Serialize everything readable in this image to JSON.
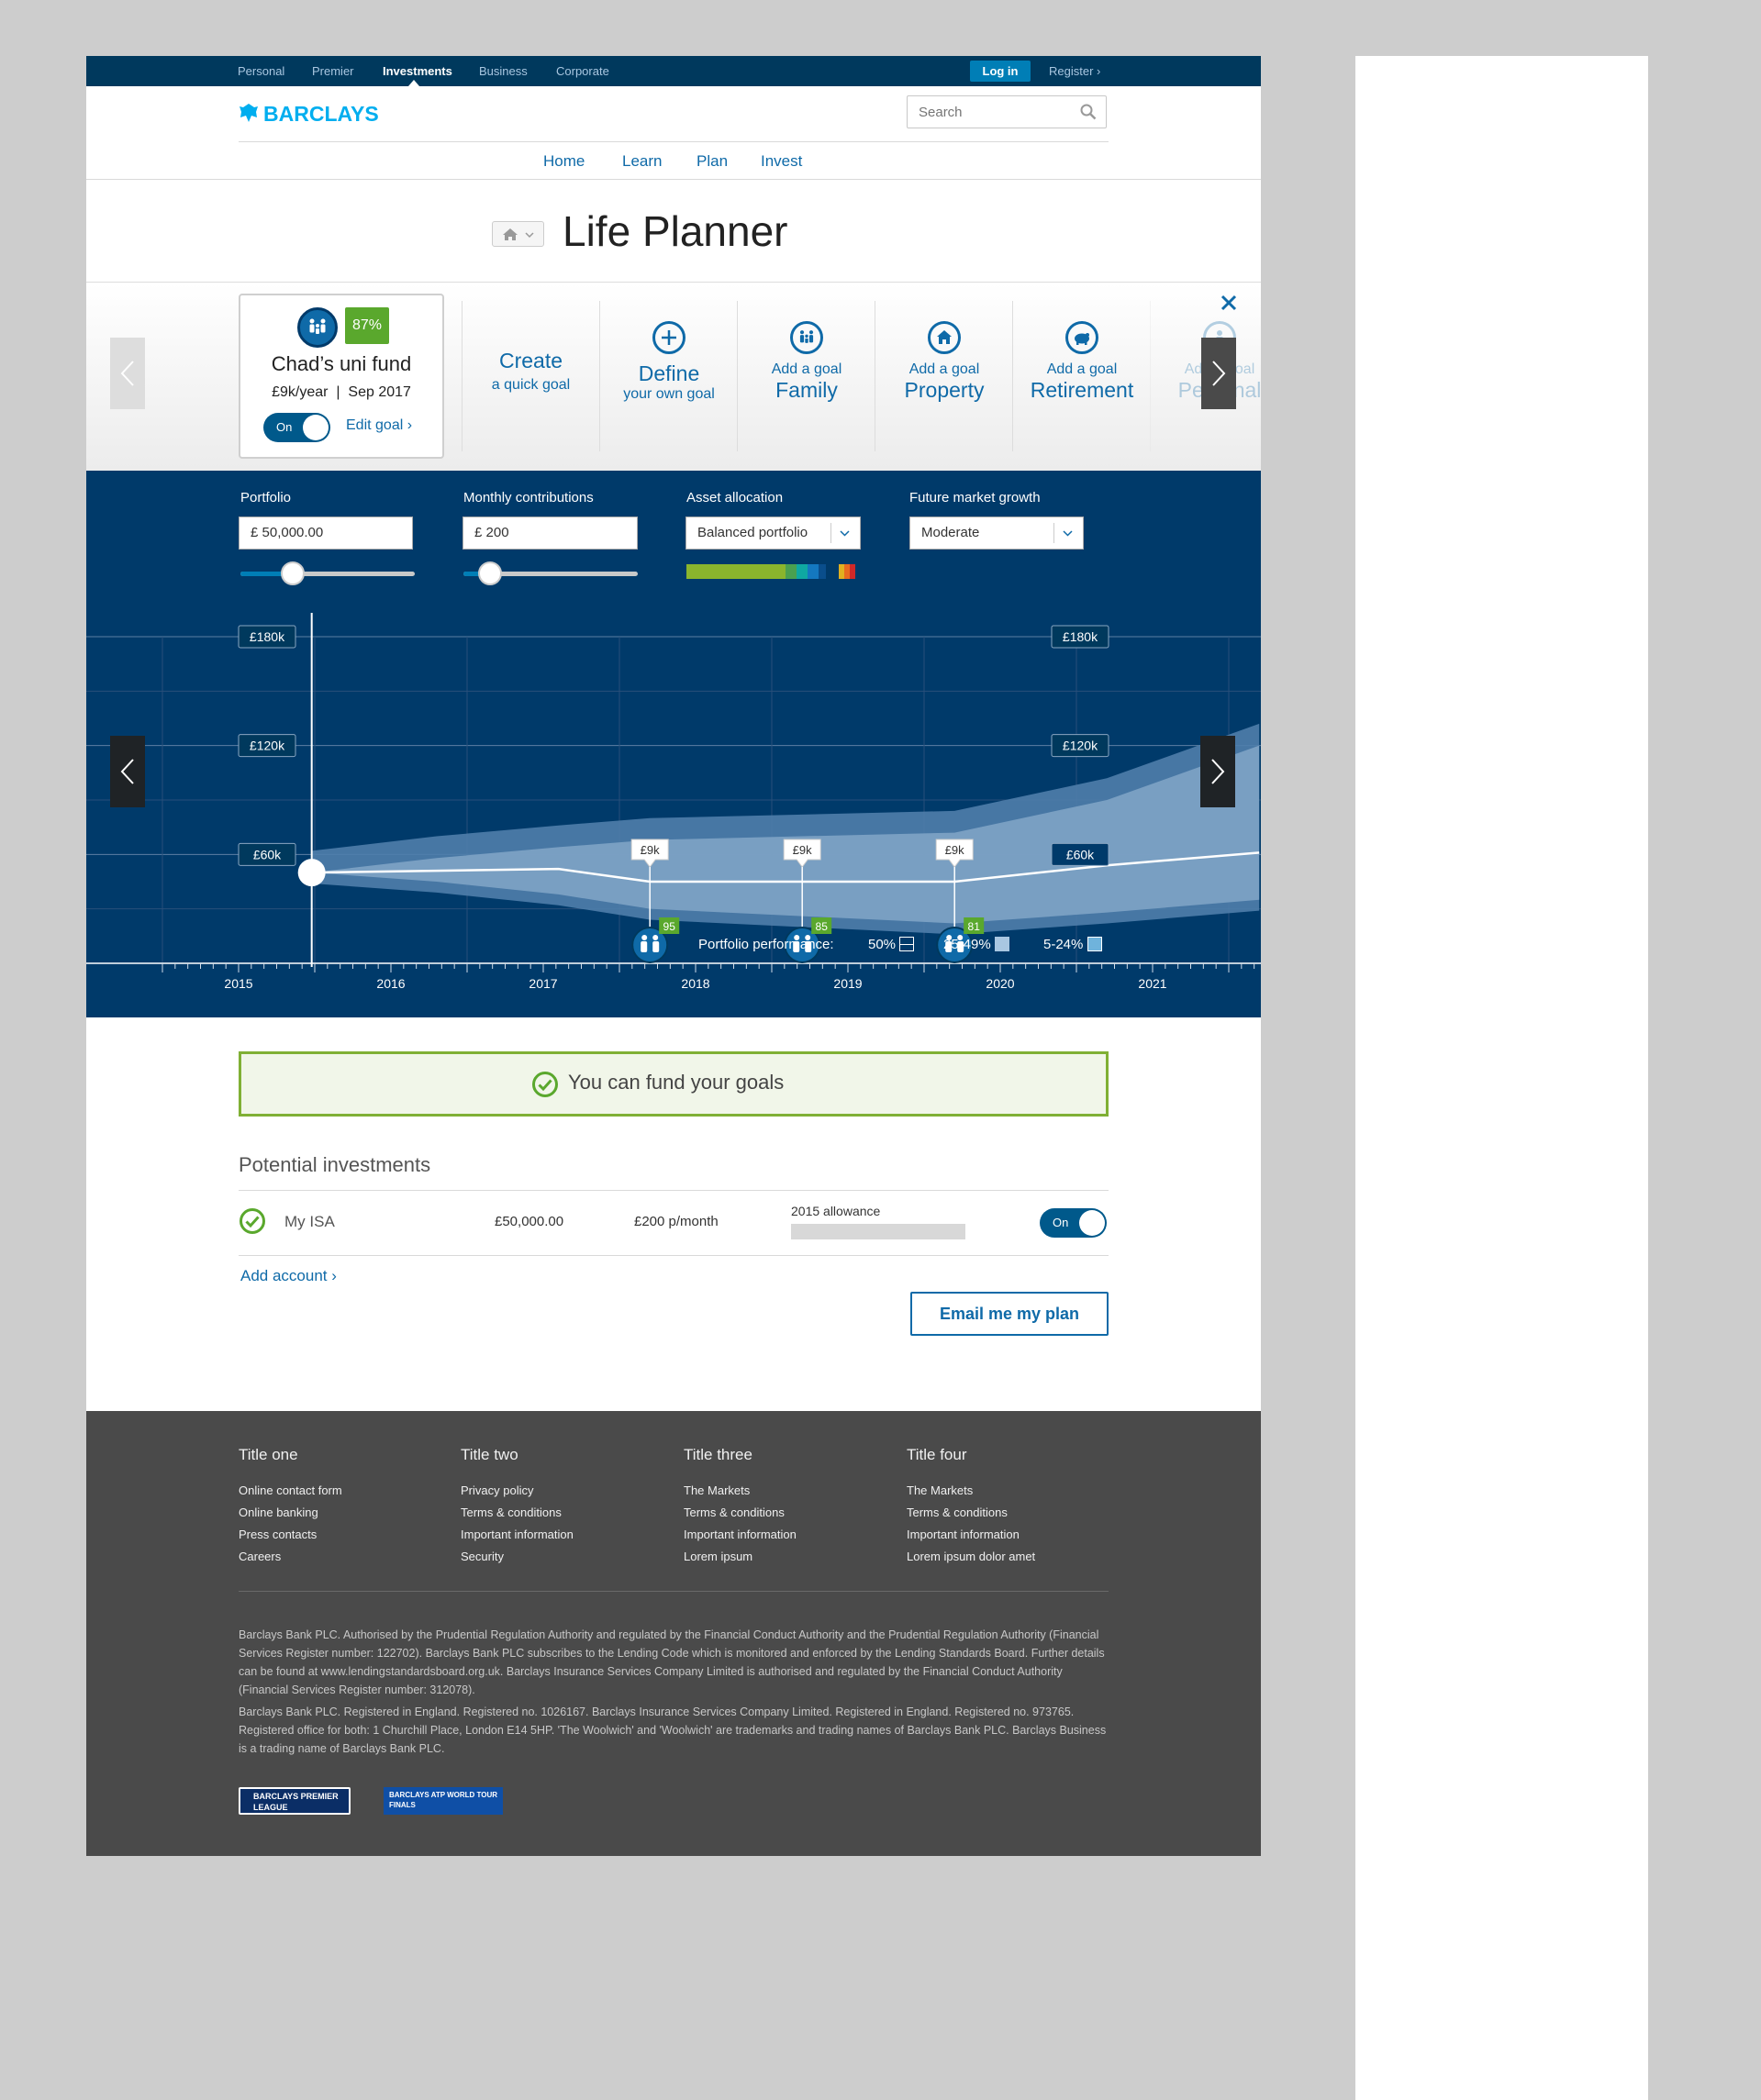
{
  "topnav": {
    "items": [
      "Personal",
      "Premier",
      "Investments",
      "Business",
      "Corporate"
    ],
    "active": "Investments",
    "login": "Log in",
    "register": "Register"
  },
  "header": {
    "logo_text": "BARCLAYS",
    "search_placeholder": "Search"
  },
  "subnav": [
    "Home",
    "Learn",
    "Plan",
    "Invest"
  ],
  "page_title": "Life Planner",
  "goal_card": {
    "title": "Chad’s uni fund",
    "percent": "87%",
    "details": "£9k/year  |  Sep 2017",
    "toggle": "On",
    "edit": "Edit goal"
  },
  "goal_options": [
    {
      "line1": "Create",
      "line2": "a quick goal"
    },
    {
      "line1": "Define",
      "line2": "your own goal"
    },
    {
      "line1": "Add a goal",
      "line2": "Family"
    },
    {
      "line1": "Add a goal",
      "line2": "Property"
    },
    {
      "line1": "Add a goal",
      "line2": "Retirement"
    },
    {
      "line1": "Add a goal",
      "line2": "Personal"
    }
  ],
  "controls": {
    "portfolio": {
      "label": "Portfolio",
      "value": "£ 50,000.00",
      "slider_level": 0.3
    },
    "monthly": {
      "label": "Monthly contributions",
      "value": "£ 200",
      "slider_level": 0.15
    },
    "allocation": {
      "label": "Asset allocation",
      "value": "Balanced portfolio"
    },
    "growth": {
      "label": "Future market growth",
      "value": "Moderate"
    }
  },
  "colors": {
    "navy": "#00395d",
    "chart_bg": "#003a6a",
    "accent": "#0f6aa8",
    "green": "#5aa82d",
    "footer": "#4a4a4a"
  },
  "chart_data": {
    "type": "area",
    "x": [
      "2015",
      "2016",
      "2017",
      "2018",
      "2019",
      "2020",
      "2021"
    ],
    "y_ticks": [
      "£180k",
      "£120k",
      "£60k"
    ],
    "ylim": [
      0,
      180
    ],
    "series": [
      {
        "name": "50%",
        "values": [
          50,
          51,
          52,
          45,
          45,
          45,
          54,
          61
        ]
      },
      {
        "name": "25-49%",
        "values": [
          50,
          58,
          64,
          68,
          70,
          72,
          90,
          120
        ]
      },
      {
        "name": "5-24%",
        "values": [
          50,
          45,
          38,
          30,
          26,
          22,
          28,
          35
        ]
      }
    ],
    "withdrawals": [
      {
        "label": "£9k",
        "year": 2017.7,
        "score": "95"
      },
      {
        "label": "£9k",
        "year": 2018.7,
        "score": "85"
      },
      {
        "label": "£9k",
        "year": 2019.7,
        "score": "81"
      }
    ],
    "current_value_label": "£60k",
    "legend_title": "Portfolio performance:",
    "legend": [
      "50%",
      "25-49%",
      "5-24%"
    ]
  },
  "fund_status": "You can fund your goals",
  "investments": {
    "title": "Potential investments",
    "rows": [
      {
        "name": "My ISA",
        "amount": "£50,000.00",
        "monthly": "£200 p/month",
        "allowance_label": "2015 allowance",
        "toggle": "On"
      }
    ],
    "add_account": "Add account",
    "email_button": "Email me my plan"
  },
  "footer": {
    "columns": [
      {
        "title": "Title one",
        "links": [
          "Online contact form",
          "Online banking",
          "Press contacts",
          "Careers"
        ]
      },
      {
        "title": "Title two",
        "links": [
          "Privacy policy",
          "Terms & conditions",
          "Important information",
          "Security"
        ]
      },
      {
        "title": "Title three",
        "links": [
          "The Markets",
          "Terms & conditions",
          "Important information",
          "Lorem ipsum"
        ]
      },
      {
        "title": "Title four",
        "links": [
          "The Markets",
          "Terms & conditions",
          "Important information",
          "Lorem ipsum dolor amet"
        ]
      }
    ],
    "legal1": "Barclays Bank PLC. Authorised by the Prudential Regulation Authority and regulated by the Financial Conduct Authority and the Prudential Regulation Authority (Financial Services Register number: 122702). Barclays Bank PLC subscribes to the Lending Code which is monitored and enforced by the Lending Standards Board. Further details can be found at www.lendingstandardsboard.org.uk. Barclays Insurance Services Company Limited is authorised and regulated by the Financial Conduct Authority (Financial Services Register number: 312078).",
    "legal2": "Barclays Bank PLC. Registered in England. Registered no. 1026167. Barclays Insurance Services Company Limited. Registered in England. Registered no. 973765. Registered office for both: 1 Churchill Place, London E14 5HP. 'The Woolwich' and 'Woolwich' are trademarks and trading names of Barclays Bank PLC. Barclays Business is a trading name of Barclays Bank PLC.",
    "sponsor1": "BARCLAYS PREMIER LEAGUE",
    "sponsor2": "BARCLAYS ATP WORLD TOUR FINALS"
  }
}
